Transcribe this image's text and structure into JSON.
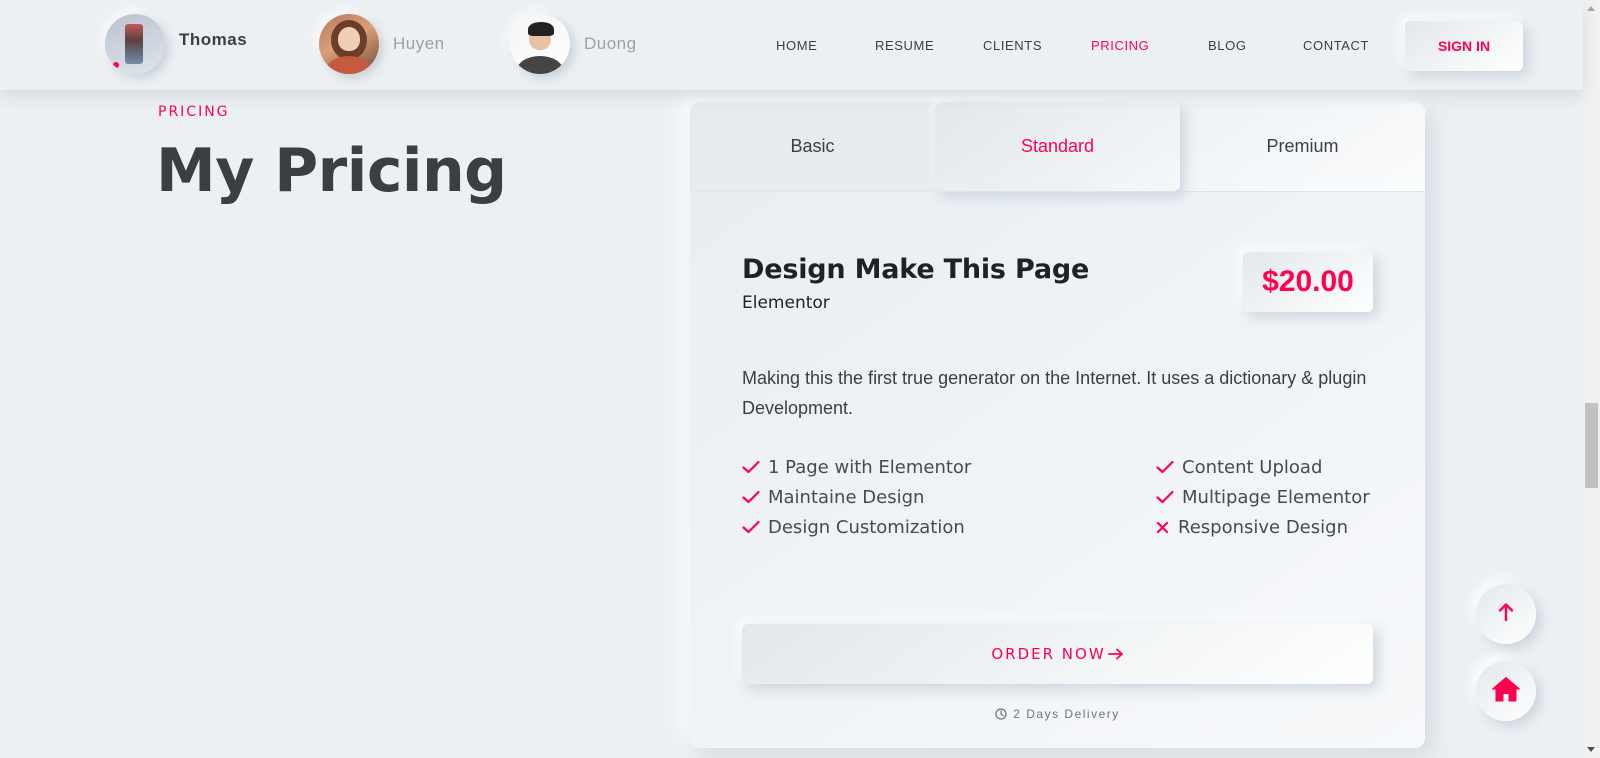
{
  "header": {
    "profiles": [
      {
        "name": "Thomas",
        "active": true
      },
      {
        "name": "Huyen",
        "active": false
      },
      {
        "name": "Duong",
        "active": false
      }
    ],
    "nav": [
      "HOME",
      "RESUME",
      "CLIENTS",
      "PRICING",
      "BLOG",
      "CONTACT"
    ],
    "active_nav": "PRICING",
    "sign_in": "SIGN IN"
  },
  "section": {
    "label": "PRICING",
    "title": "My Pricing"
  },
  "pricing": {
    "tabs": [
      "Basic",
      "Standard",
      "Premium"
    ],
    "active_tab": "Standard",
    "plan_title": "Design Make This Page",
    "plan_subtitle": "Elementor",
    "price": "$20.00",
    "description": "Making this the first true generator on the Internet. It uses a dictionary & plugin Development.",
    "features_left": [
      {
        "label": "1 Page with Elementor",
        "included": true
      },
      {
        "label": "Maintaine Design",
        "included": true
      },
      {
        "label": "Design Customization",
        "included": true
      }
    ],
    "features_right": [
      {
        "label": "Content Upload",
        "included": true
      },
      {
        "label": "Multipage Elementor",
        "included": true
      },
      {
        "label": "Responsive Design",
        "included": false
      }
    ],
    "order_button": "ORDER NOW",
    "delivery": "2 Days Delivery"
  },
  "floating": {
    "up_icon": "arrow-up-icon",
    "home_icon": "home-icon"
  },
  "colors": {
    "accent": "#ff014f",
    "background": "#ecf0f3",
    "text": "#3c3e41"
  }
}
